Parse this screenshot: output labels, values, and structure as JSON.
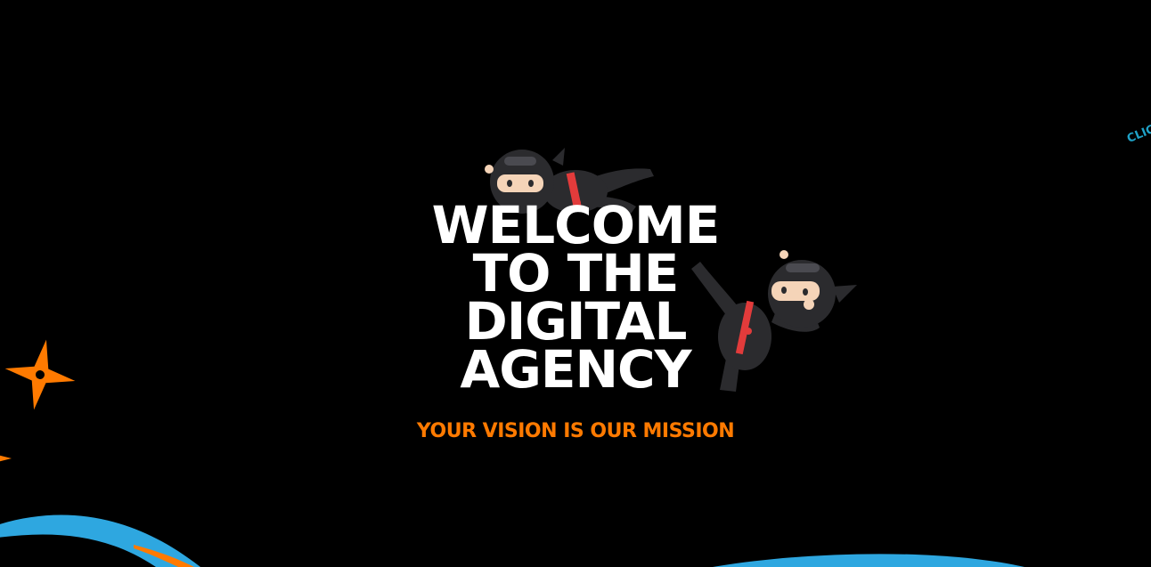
{
  "hero": {
    "title_lines": [
      "WELCOME",
      "TO THE",
      "DIGITAL",
      "AGENCY"
    ],
    "tagline": "YOUR VISION IS OUR MISSION"
  },
  "corner_link": {
    "label": "CLICK"
  },
  "illustrations": {
    "flying_ninja": "flying-ninja-illustration",
    "kicking_ninja": "kicking-ninja-illustration",
    "shuriken_icon": "shuriken-icon"
  },
  "colors": {
    "background": "#000000",
    "title": "#ffffff",
    "tagline": "#ff7a00",
    "accent_orange": "#ff7a00",
    "accent_blue": "#2ea7e0",
    "link": "#1fa2c7",
    "ninja_suit": "#2b2b2e",
    "ninja_sash": "#e23b3b",
    "skin": "#f5d4b8"
  }
}
